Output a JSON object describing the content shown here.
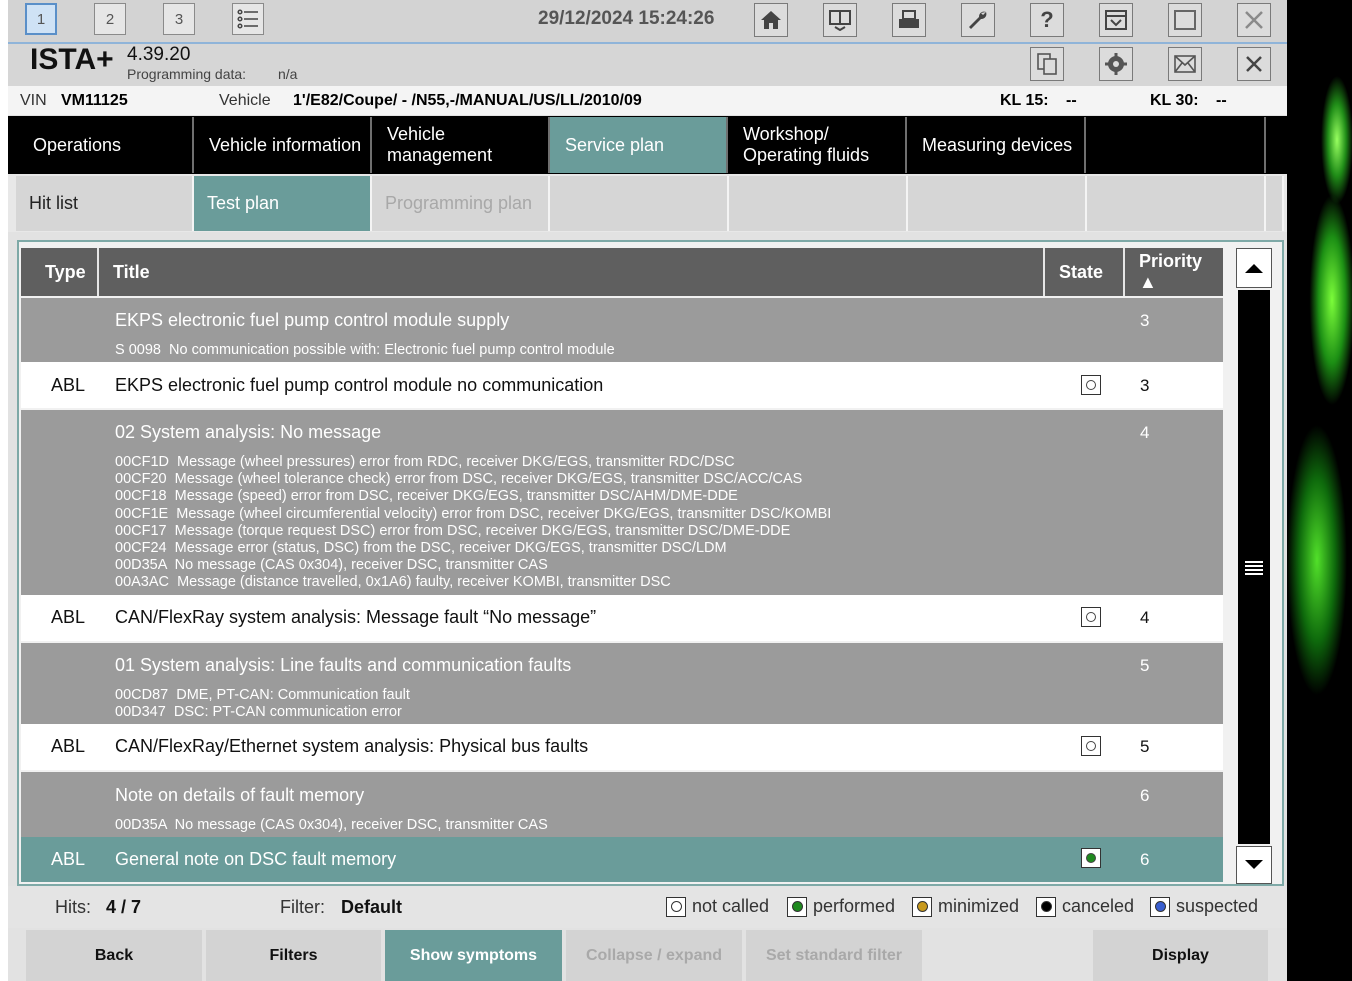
{
  "window_buttons": [
    "1",
    "2",
    "3"
  ],
  "datetime": "29/12/2024 15:24:26",
  "app": {
    "name": "ISTA+",
    "version": "4.39.20",
    "programming_label": "Programming data:",
    "programming_value": "n/a"
  },
  "vehicle_line": {
    "vin_label": "VIN",
    "vin_value": "VM11125",
    "vehicle_label": "Vehicle",
    "vehicle_value": "1'/E82/Coupe/ - /N55,-/MANUAL/US/LL/2010/09",
    "kl15_label": "KL 15:",
    "kl15_value": "--",
    "kl30_label": "KL 30:",
    "kl30_value": "--"
  },
  "main_tabs": [
    {
      "label": "Operations"
    },
    {
      "label": "Vehicle information"
    },
    {
      "label": "Vehicle\nmanagement"
    },
    {
      "label": "Service plan"
    },
    {
      "label": "Workshop/\nOperating fluids"
    },
    {
      "label": "Measuring devices"
    }
  ],
  "sub_tabs": [
    {
      "label": "Hit list"
    },
    {
      "label": "Test plan"
    },
    {
      "label": "Programming plan"
    }
  ],
  "table": {
    "headers": {
      "type": "Type",
      "title": "Title",
      "state": "State",
      "priority": "Priority ▲"
    },
    "groups": [
      {
        "title": "EKPS electronic fuel pump control module supply",
        "priority": "3",
        "details": "S 0098  No communication possible with: Electronic fuel pump control module",
        "row": {
          "type": "ABL",
          "title": "EKPS electronic fuel pump control module no communication",
          "state": "not called",
          "priority": "3"
        }
      },
      {
        "title": "02 System analysis: No message",
        "priority": "4",
        "details": "00CF1D  Message (wheel pressures) error from RDC, receiver DKG/EGS, transmitter RDC/DSC\n00CF20  Message (wheel tolerance check) error from DSC, receiver DKG/EGS, transmitter DSC/ACC/CAS\n00CF18  Message (speed) error from DSC, receiver DKG/EGS, transmitter DSC/AHM/DME-DDE\n00CF1E  Message (wheel circumferential velocity) error from DSC, receiver DKG/EGS, transmitter DSC/KOMBI\n00CF17  Message (torque request DSC) error from DSC, receiver DKG/EGS, transmitter DSC/DME-DDE\n00CF24  Message error (status, DSC) from the DSC, receiver DKG/EGS, transmitter DSC/LDM\n00D35A  No message (CAS 0x304), receiver DSC, transmitter CAS\n00A3AC  Message (distance travelled, 0x1A6) faulty, receiver KOMBI, transmitter DSC",
        "row": {
          "type": "ABL",
          "title": "CAN/FlexRay system analysis: Message fault “No message”",
          "state": "not called",
          "priority": "4"
        }
      },
      {
        "title": "01 System analysis: Line faults and communication faults",
        "priority": "5",
        "details": "00CD87  DME, PT-CAN: Communication fault\n00D347  DSC: PT-CAN communication error",
        "row": {
          "type": "ABL",
          "title": "CAN/FlexRay/Ethernet system analysis: Physical bus faults",
          "state": "not called",
          "priority": "5"
        }
      },
      {
        "title": "Note on details of fault memory",
        "priority": "6",
        "details": "00D35A  No message (CAS 0x304), receiver DSC, transmitter CAS",
        "row": {
          "type": "ABL",
          "title": "General note on DSC fault memory",
          "state": "performed",
          "priority": "6"
        }
      }
    ]
  },
  "status": {
    "hits_label": "Hits:",
    "hits_value": "4 / 7",
    "filter_label": "Filter:",
    "filter_value": "Default",
    "legend": [
      {
        "label": "not called",
        "color": ""
      },
      {
        "label": "performed",
        "color": "#1f8a1f"
      },
      {
        "label": "minimized",
        "color": "#c89a1e"
      },
      {
        "label": "canceled",
        "color": "#000000"
      },
      {
        "label": "suspected",
        "color": "#3a5fd0"
      }
    ]
  },
  "bottom_buttons": [
    "Back",
    "Filters",
    "Show symptoms",
    "Collapse / expand",
    "Set standard filter",
    "Display"
  ],
  "colors": {
    "accent": "#6a9c9a",
    "header": "#5f5f5f",
    "group": "#9b9b9b"
  }
}
